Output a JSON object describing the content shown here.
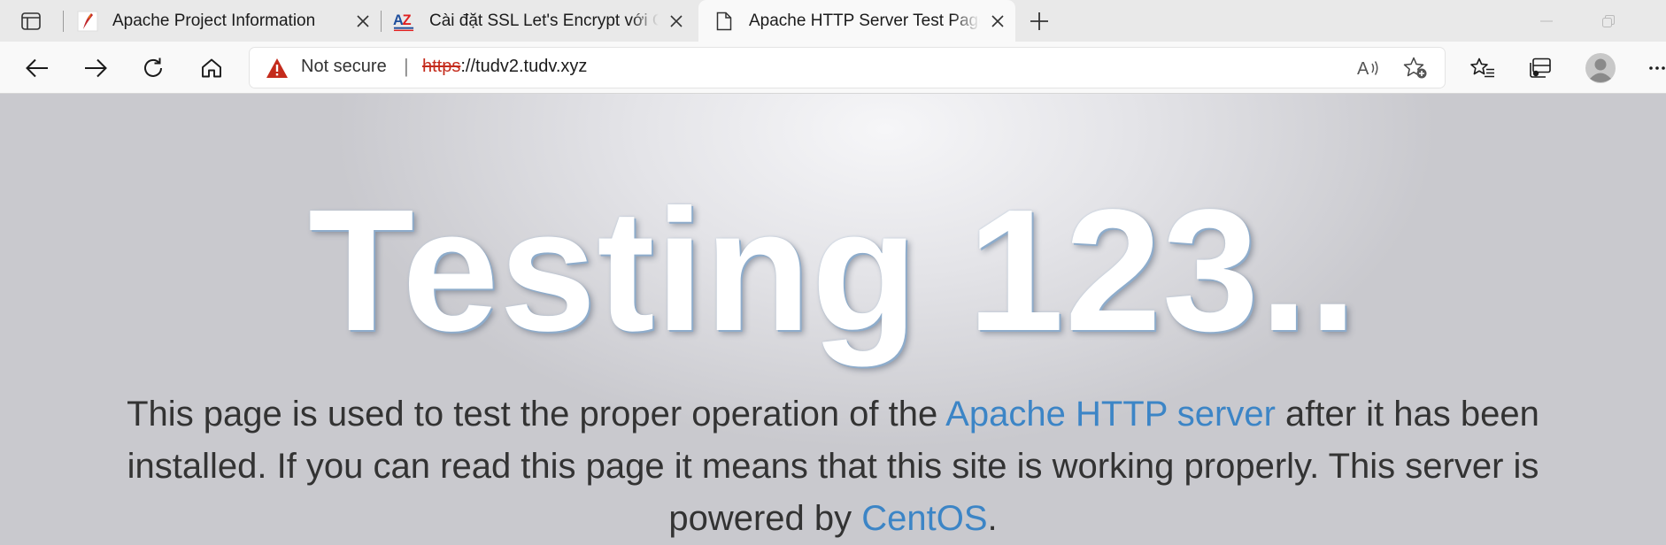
{
  "browser": {
    "tabs": [
      {
        "title": "Apache Project Information",
        "active": false,
        "favicon": "apache-feather-icon"
      },
      {
        "title": "Cài đặt SSL Let's Encrypt với Cert",
        "active": false,
        "favicon": "azdigi-logo-icon"
      },
      {
        "title": "Apache HTTP Server Test Page po",
        "active": true,
        "favicon": "page-icon"
      }
    ],
    "address_bar": {
      "security_label": "Not secure",
      "url_scheme": "https",
      "url_rest": "://tudv2.tudv.xyz"
    }
  },
  "page": {
    "heading": "Testing 123..",
    "paragraph": {
      "text1": "This page is used to test the proper operation of the ",
      "link1": "Apache HTTP server",
      "text2": " after it has been installed. If you can read this page it means that this site is working properly. This server is powered by ",
      "link2": "CentOS",
      "text3": "."
    }
  },
  "colors": {
    "link": "#3c85c6",
    "warning": "#c42b1c",
    "text": "#333333"
  }
}
